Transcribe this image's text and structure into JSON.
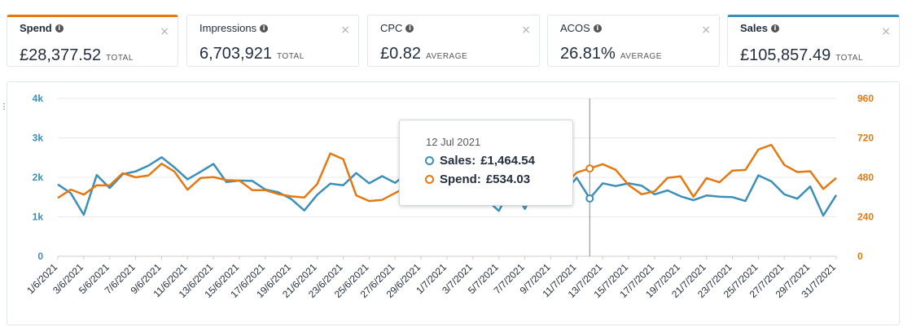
{
  "cards": [
    {
      "id": "spend",
      "label": "Spend",
      "value": "£28,377.52",
      "suffix": "TOTAL",
      "selected": true,
      "accent": "#e47911"
    },
    {
      "id": "impressions",
      "label": "Impressions",
      "value": "6,703,921",
      "suffix": "TOTAL",
      "selected": false
    },
    {
      "id": "cpc",
      "label": "CPC",
      "value": "£0.82",
      "suffix": "AVERAGE",
      "selected": false
    },
    {
      "id": "acos",
      "label": "ACOS",
      "value": "26.81%",
      "suffix": "AVERAGE",
      "selected": false
    },
    {
      "id": "sales",
      "label": "Sales",
      "value": "£105,857.49",
      "suffix": "TOTAL",
      "selected": true,
      "accent": "#3b8fb8"
    }
  ],
  "icons": {
    "info": "info-icon",
    "close": "close-icon"
  },
  "close_glyph": "×",
  "info_glyph": "i",
  "tooltip": {
    "date": "12 Jul 2021",
    "rows": [
      {
        "series": "sales",
        "label": "Sales:",
        "value": "£1,464.54"
      },
      {
        "series": "spend",
        "label": "Spend:",
        "value": "£534.03"
      }
    ]
  },
  "colors": {
    "sales": "#3b8fb8",
    "spend": "#e47911",
    "grid": "#e8e8e8",
    "crosshair": "#888888"
  },
  "chart_data": {
    "type": "line",
    "x": [
      "1/6/2021",
      "2/6/2021",
      "3/6/2021",
      "4/6/2021",
      "5/6/2021",
      "6/6/2021",
      "7/6/2021",
      "8/6/2021",
      "9/6/2021",
      "10/6/2021",
      "11/6/2021",
      "12/6/2021",
      "13/6/2021",
      "14/6/2021",
      "15/6/2021",
      "16/6/2021",
      "17/6/2021",
      "18/6/2021",
      "19/6/2021",
      "20/6/2021",
      "21/6/2021",
      "22/6/2021",
      "23/6/2021",
      "24/6/2021",
      "25/6/2021",
      "26/6/2021",
      "27/6/2021",
      "28/6/2021",
      "29/6/2021",
      "30/6/2021",
      "1/7/2021",
      "2/7/2021",
      "3/7/2021",
      "4/7/2021",
      "5/7/2021",
      "6/7/2021",
      "7/7/2021",
      "8/7/2021",
      "9/7/2021",
      "10/7/2021",
      "11/7/2021",
      "12/7/2021",
      "13/7/2021",
      "14/7/2021",
      "15/7/2021",
      "16/7/2021",
      "17/7/2021",
      "18/7/2021",
      "19/7/2021",
      "20/7/2021",
      "21/7/2021",
      "22/7/2021",
      "23/7/2021",
      "24/7/2021",
      "25/7/2021",
      "26/7/2021",
      "27/7/2021",
      "28/7/2021",
      "29/7/2021",
      "30/7/2021",
      "31/7/2021"
    ],
    "x_tick_labels": [
      "1/6/2021",
      "3/6/2021",
      "5/6/2021",
      "7/6/2021",
      "9/6/2021",
      "11/6/2021",
      "13/6/2021",
      "15/6/2021",
      "17/6/2021",
      "19/6/2021",
      "21/6/2021",
      "23/6/2021",
      "25/6/2021",
      "27/6/2021",
      "29/6/2021",
      "1/7/2021",
      "3/7/2021",
      "5/7/2021",
      "7/7/2021",
      "9/7/2021",
      "11/7/2021",
      "13/7/2021",
      "15/7/2021",
      "17/7/2021",
      "19/7/2021",
      "21/7/2021",
      "23/7/2021",
      "25/7/2021",
      "27/7/2021",
      "29/7/2021",
      "31/7/2021"
    ],
    "series": [
      {
        "name": "Sales",
        "axis": "left",
        "color": "#3b8fb8",
        "values": [
          1820,
          1600,
          1050,
          2060,
          1730,
          2080,
          2150,
          2300,
          2510,
          2250,
          1950,
          2140,
          2340,
          1880,
          1920,
          1910,
          1690,
          1620,
          1450,
          1160,
          1560,
          1840,
          1800,
          2110,
          1850,
          2030,
          1860,
          2130,
          2080,
          2000,
          1900,
          1700,
          1600,
          1450,
          1150,
          1800,
          1200,
          1850,
          2000,
          1600,
          1990,
          1465,
          1850,
          1780,
          1850,
          1790,
          1570,
          1670,
          1520,
          1420,
          1540,
          1510,
          1500,
          1400,
          2050,
          1900,
          1570,
          1460,
          1770,
          1030,
          1550
        ]
      },
      {
        "name": "Spend",
        "axis": "right",
        "color": "#e47911",
        "values": [
          355,
          406,
          375,
          432,
          431,
          505,
          480,
          492,
          563,
          514,
          405,
          476,
          482,
          463,
          460,
          402,
          402,
          378,
          364,
          358,
          440,
          625,
          591,
          370,
          336,
          343,
          385,
          424,
          440,
          430,
          422,
          410,
          400,
          390,
          380,
          420,
          370,
          420,
          440,
          430,
          509,
          534,
          560,
          526,
          433,
          377,
          395,
          477,
          486,
          362,
          475,
          450,
          521,
          525,
          649,
          678,
          555,
          512,
          517,
          409,
          476
        ]
      }
    ],
    "y_left": {
      "ticks": [
        "0",
        "1k",
        "2k",
        "3k",
        "4k"
      ],
      "ylim": [
        0,
        4000
      ]
    },
    "y_right": {
      "ticks": [
        "0",
        "240",
        "480",
        "720",
        "960"
      ],
      "ylim": [
        0,
        960
      ]
    },
    "highlight_index": 41,
    "grid": true
  }
}
